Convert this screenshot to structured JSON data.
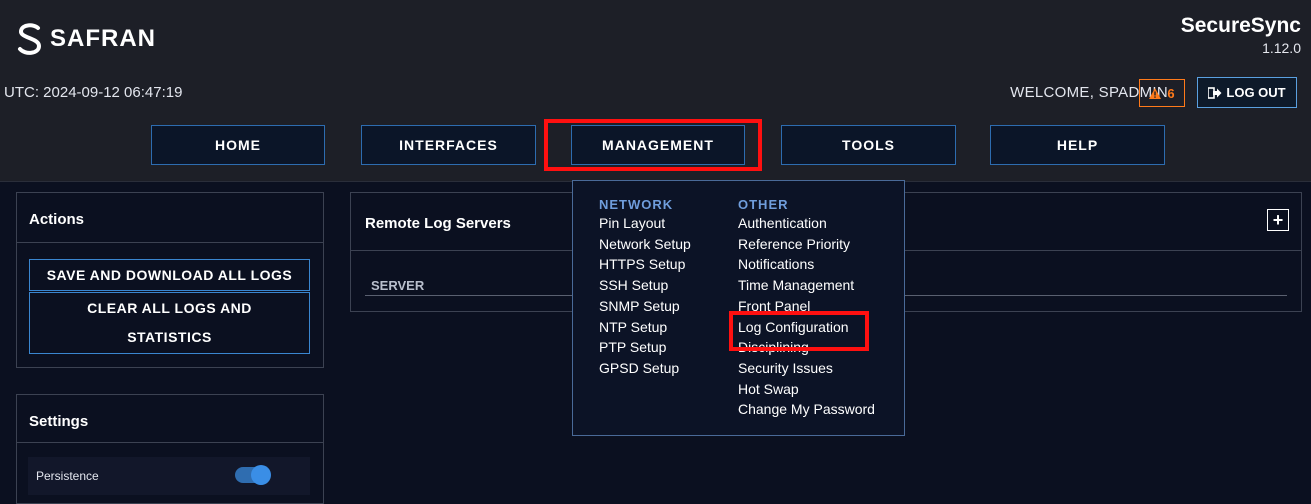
{
  "header": {
    "brand": "SAFRAN",
    "product_name": "SecureSync",
    "version": "1.12.0",
    "utc_time": "UTC: 2024-09-12 06:47:19",
    "welcome": "WELCOME, SPADMIN",
    "alert_count": "6",
    "logout_label": "LOG OUT"
  },
  "nav": {
    "home": "HOME",
    "interfaces": "INTERFACES",
    "management": "MANAGEMENT",
    "tools": "TOOLS",
    "help": "HELP"
  },
  "actions_panel": {
    "title": "Actions",
    "save_download": "SAVE AND DOWNLOAD ALL LOGS",
    "clear_line1": "CLEAR ALL LOGS AND",
    "clear_line2": "STATISTICS"
  },
  "settings_panel": {
    "title": "Settings",
    "persistence_label": "Persistence",
    "persistence_on": true
  },
  "remote_log_panel": {
    "title": "Remote Log Servers",
    "add_label": "+",
    "column_server": "SERVER"
  },
  "dropdown": {
    "network_heading": "NETWORK",
    "network_items": [
      "Pin Layout",
      "Network Setup",
      "HTTPS Setup",
      "SSH Setup",
      "SNMP Setup",
      "NTP Setup",
      "PTP Setup",
      "GPSD Setup"
    ],
    "other_heading": "OTHER",
    "other_items": [
      "Authentication",
      "Reference Priority",
      "Notifications",
      "Time Management",
      "Front Panel",
      "Log Configuration",
      "Disciplining",
      "Security Issues",
      "Hot Swap",
      "Change My Password"
    ]
  },
  "colors": {
    "accent_blue": "#3a86d0",
    "highlight_red": "#ff1010",
    "alert_orange": "#ff7a1a",
    "heading_blue": "#6f9ddc"
  },
  "icons": {
    "logo": "safran-logo-icon",
    "alert": "warning-triangle-icon",
    "logout": "logout-icon",
    "add": "plus-icon"
  }
}
